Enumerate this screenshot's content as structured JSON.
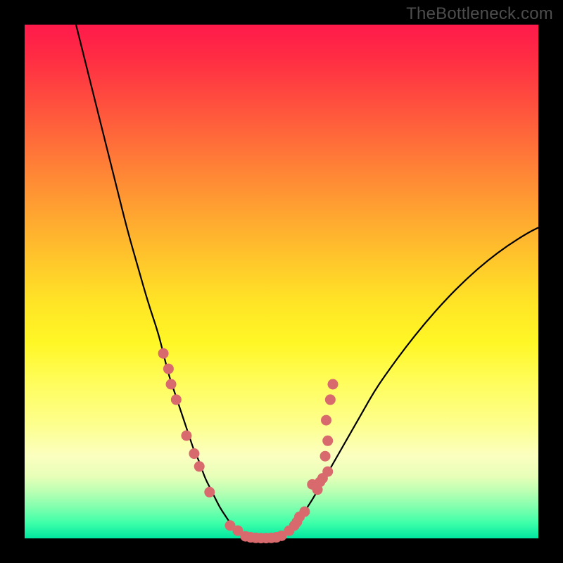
{
  "watermark": "TheBottleneck.com",
  "colors": {
    "bg_black": "#000000",
    "watermark_gray": "#4d4d4d",
    "curve_stroke": "#000000",
    "dot_fill": "#d86a6e"
  },
  "chart_data": {
    "type": "line",
    "title": "",
    "xlabel": "",
    "ylabel": "",
    "xlim": [
      0,
      100
    ],
    "ylim": [
      0,
      100
    ],
    "series": [
      {
        "name": "bottleneck-curve",
        "x": [
          10,
          12,
          14,
          16,
          18,
          20,
          22,
          24,
          26,
          27,
          28,
          29,
          30,
          31,
          32,
          33,
          34,
          35,
          36,
          37,
          38,
          39,
          40,
          41,
          42,
          43,
          44,
          45,
          46,
          47,
          48,
          49,
          50,
          51,
          52,
          53,
          54,
          56,
          58,
          60,
          62,
          64,
          66,
          68,
          70,
          74,
          78,
          82,
          86,
          90,
          94,
          98,
          100
        ],
        "y": [
          100,
          92,
          84,
          76,
          68,
          60,
          53,
          46,
          40,
          36,
          32,
          29,
          26,
          23,
          20,
          17,
          15,
          12,
          10,
          8,
          6,
          4.5,
          3,
          2,
          1.2,
          0.6,
          0.3,
          0.1,
          0,
          0,
          0.1,
          0.3,
          0.7,
          1.2,
          2,
          3,
          4.5,
          7.5,
          11,
          14.5,
          18,
          21.5,
          25,
          28.5,
          31.5,
          37,
          42,
          46.5,
          50.5,
          54,
          57,
          59.5,
          60.5
        ]
      }
    ],
    "scatter": [
      {
        "name": "left-dots",
        "points": [
          {
            "x": 27.0,
            "y": 36
          },
          {
            "x": 28.0,
            "y": 33
          },
          {
            "x": 28.5,
            "y": 30
          },
          {
            "x": 29.5,
            "y": 27
          },
          {
            "x": 31.5,
            "y": 20
          },
          {
            "x": 33.0,
            "y": 16.5
          },
          {
            "x": 34.0,
            "y": 14
          },
          {
            "x": 36.0,
            "y": 9
          },
          {
            "x": 40.0,
            "y": 2.5
          },
          {
            "x": 41.5,
            "y": 1.5
          }
        ]
      },
      {
        "name": "bottom-dots",
        "points": [
          {
            "x": 43.0,
            "y": 0.4
          },
          {
            "x": 44.0,
            "y": 0.2
          },
          {
            "x": 45.0,
            "y": 0.1
          },
          {
            "x": 46.0,
            "y": 0.05
          },
          {
            "x": 47.0,
            "y": 0.05
          },
          {
            "x": 48.0,
            "y": 0.1
          },
          {
            "x": 49.0,
            "y": 0.2
          },
          {
            "x": 50.0,
            "y": 0.5
          }
        ]
      },
      {
        "name": "right-dots",
        "points": [
          {
            "x": 51.5,
            "y": 1.5
          },
          {
            "x": 52.5,
            "y": 2.5
          },
          {
            "x": 53.0,
            "y": 3.2
          },
          {
            "x": 53.5,
            "y": 4.2
          },
          {
            "x": 54.5,
            "y": 5.2
          },
          {
            "x": 57.0,
            "y": 9.5
          },
          {
            "x": 56.0,
            "y": 10.5
          },
          {
            "x": 57.5,
            "y": 11
          },
          {
            "x": 58.0,
            "y": 11.7
          },
          {
            "x": 59.0,
            "y": 13
          },
          {
            "x": 58.5,
            "y": 16
          },
          {
            "x": 59.0,
            "y": 19
          },
          {
            "x": 58.7,
            "y": 23
          },
          {
            "x": 59.5,
            "y": 27
          },
          {
            "x": 60.0,
            "y": 30
          }
        ]
      }
    ]
  }
}
